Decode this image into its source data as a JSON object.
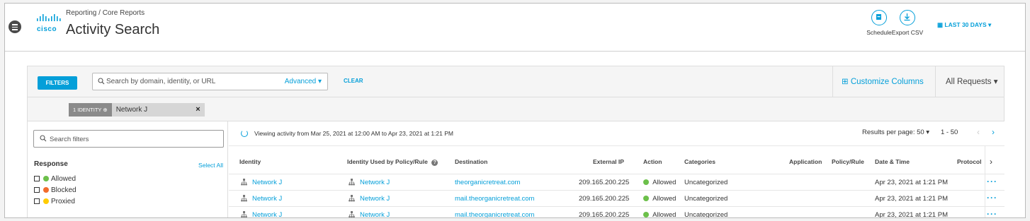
{
  "header": {
    "breadcrumb": "Reporting / Core Reports",
    "title": "Activity Search",
    "logo_text": "cisco",
    "schedule_label": "Schedule",
    "export_label": "Export CSV",
    "date_range": "LAST 30 DAYS ▾"
  },
  "toolbar": {
    "filters_label": "FILTERS",
    "search_placeholder": "Search by domain, identity, or URL",
    "advanced_label": "Advanced ▾",
    "clear_label": "CLEAR",
    "customize_label": "Customize Columns",
    "requests_label": "All Requests ▾"
  },
  "chip": {
    "count_label": "1 IDENTITY",
    "value": "Network J",
    "remove": "×"
  },
  "filter_panel": {
    "search_placeholder": "Search filters",
    "response_title": "Response",
    "select_all": "Select All",
    "items": [
      {
        "label": "Allowed",
        "color": "#6cc04a"
      },
      {
        "label": "Blocked",
        "color": "#f26b2b"
      },
      {
        "label": "Proxied",
        "color": "#ffcc00"
      }
    ]
  },
  "results": {
    "viewing_text": "Viewing activity from Mar 25, 2021 at 12:00 AM to Apr 23, 2021 at 1:21 PM",
    "results_per_page": "Results per page:  50  ▾",
    "range": "1 - 50",
    "prev": "‹",
    "next": "›",
    "columns": {
      "identity": "Identity",
      "identity_policy": "Identity Used by Policy/Rule",
      "destination": "Destination",
      "external_ip": "External IP",
      "action": "Action",
      "categories": "Categories",
      "application": "Application",
      "policy_rule": "Policy/Rule",
      "datetime": "Date & Time",
      "protocol": "Protocol"
    },
    "rows": [
      {
        "identity": "Network J",
        "identity_policy": "Network J",
        "destination": "theorganicretreat.com",
        "external_ip": "209.165.200.225",
        "action": "Allowed",
        "categories": "Uncategorized",
        "datetime": "Apr 23, 2021 at 1:21 PM"
      },
      {
        "identity": "Network J",
        "identity_policy": "Network J",
        "destination": "mail.theorganicretreat.com",
        "external_ip": "209.165.200.225",
        "action": "Allowed",
        "categories": "Uncategorized",
        "datetime": "Apr 23, 2021 at 1:21 PM"
      },
      {
        "identity": "Network J",
        "identity_policy": "Network J",
        "destination": "mail.theorganicretreat.com",
        "external_ip": "209.165.200.225",
        "action": "Allowed",
        "categories": "Uncategorized",
        "datetime": "Apr 23, 2021 at 1:21 PM"
      }
    ],
    "more_label": "···"
  },
  "colors": {
    "accent": "#049fd9",
    "allowed": "#6cc04a",
    "blocked": "#f26b2b",
    "proxied": "#ffcc00"
  }
}
